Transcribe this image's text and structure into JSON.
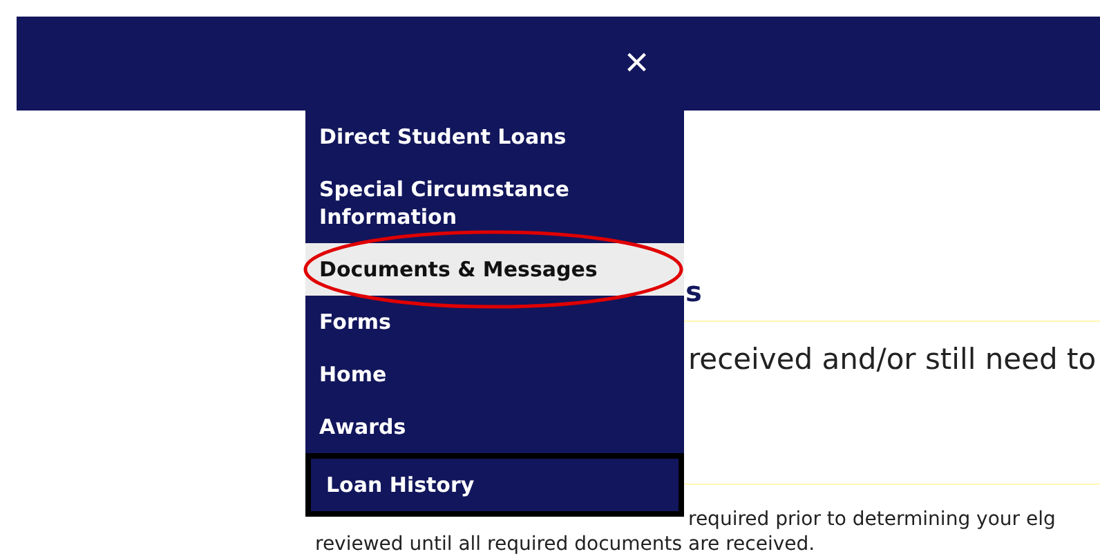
{
  "header": {
    "close_icon": "×"
  },
  "page": {
    "heading_fragment": "s",
    "intro_fragment": "received and/or still need to",
    "note_line_1": "required prior to determining your elg",
    "note_line_2": "reviewed until all required documents are received."
  },
  "menu": {
    "items": [
      {
        "label": "Direct Student Loans",
        "selected": false,
        "focused": false
      },
      {
        "label": "Special Circumstance Information",
        "selected": false,
        "focused": false
      },
      {
        "label": "Documents & Messages",
        "selected": true,
        "focused": false
      },
      {
        "label": "Forms",
        "selected": false,
        "focused": false
      },
      {
        "label": "Home",
        "selected": false,
        "focused": false
      },
      {
        "label": "Awards",
        "selected": false,
        "focused": false
      },
      {
        "label": "Loan History",
        "selected": false,
        "focused": true
      }
    ]
  }
}
